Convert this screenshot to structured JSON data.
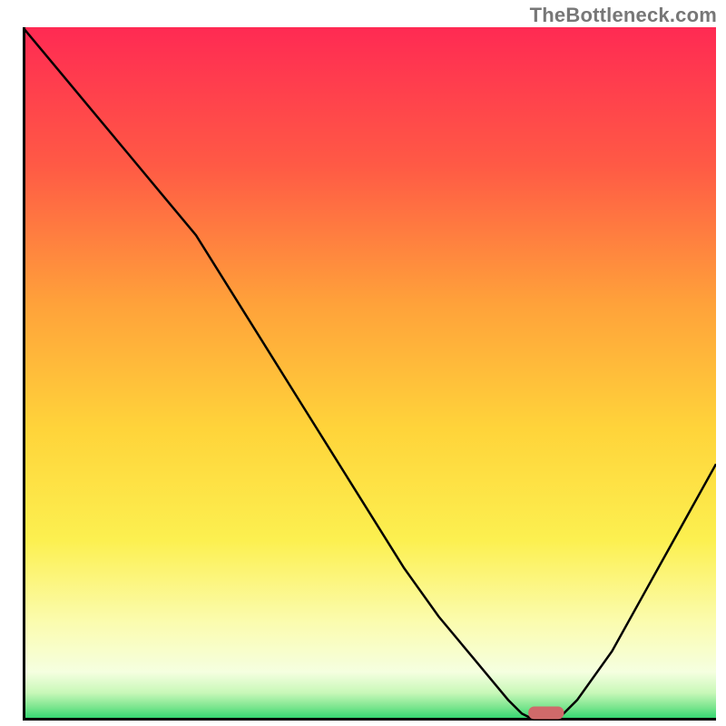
{
  "attribution": "TheBottleneck.com",
  "colors": {
    "gradient_top": "#ff2a53",
    "gradient_upper_mid": "#ff7a3a",
    "gradient_mid": "#ffd43a",
    "gradient_lower_mid": "#f9f96a",
    "gradient_low": "#faffd0",
    "gradient_bottom": "#25d36a",
    "curve": "#000000",
    "axis": "#000000",
    "marker": "#cf6a6a"
  },
  "chart_data": {
    "type": "line",
    "title": "",
    "xlabel": "",
    "ylabel": "",
    "xlim": [
      0,
      100
    ],
    "ylim": [
      0,
      100
    ],
    "grid": false,
    "legend": false,
    "x": [
      0,
      5,
      10,
      15,
      20,
      25,
      30,
      35,
      40,
      45,
      50,
      55,
      60,
      65,
      70,
      72,
      74,
      76,
      78,
      80,
      85,
      90,
      95,
      100
    ],
    "series": [
      {
        "name": "bottleneck-curve",
        "values": [
          100,
          94,
          88,
          82,
          76,
          70,
          62,
          54,
          46,
          38,
          30,
          22,
          15,
          9,
          3,
          1,
          0,
          0,
          1,
          3,
          10,
          19,
          28,
          37
        ]
      }
    ],
    "annotations": [
      {
        "name": "optimal-marker",
        "x_start": 73,
        "x_end": 78,
        "y": 0,
        "color": "#cf6a6a"
      }
    ]
  }
}
